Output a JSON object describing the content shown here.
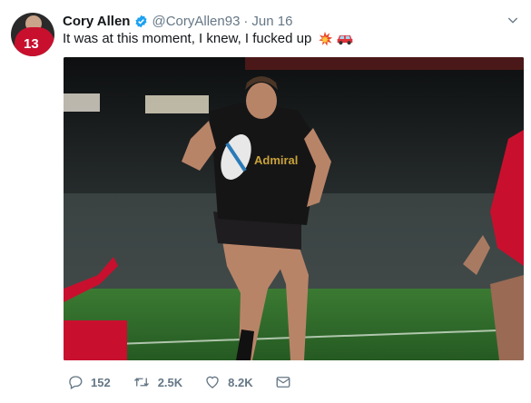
{
  "tweet": {
    "author_name": "Cory Allen",
    "handle": "@CoryAllen93",
    "separator": "·",
    "date": "Jun 16",
    "text": "It was at this moment, I knew, I fucked up",
    "avatar_number": "13",
    "media_shirt_text": "Admiral"
  },
  "actions": {
    "replies": "152",
    "retweets": "2.5K",
    "likes": "8.2K"
  },
  "icons": {
    "verified": "verified-badge-icon",
    "caret": "chevron-down-icon",
    "reply": "reply-icon",
    "retweet": "retweet-icon",
    "like": "heart-icon",
    "dm": "envelope-icon"
  },
  "colors": {
    "verified_blue": "#1da1f2",
    "muted_text": "#657786",
    "pitch_green": "#2f6b2a",
    "welsh_red": "#c8102e"
  }
}
